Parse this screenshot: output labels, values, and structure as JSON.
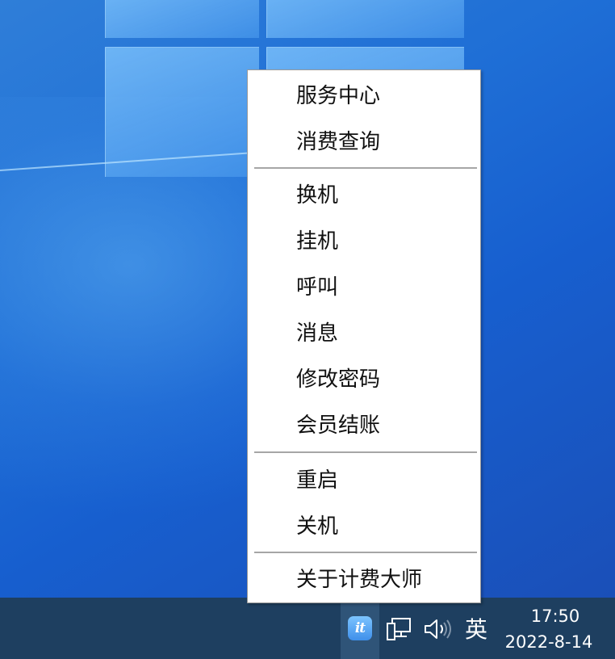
{
  "context_menu": {
    "groups": [
      {
        "items": [
          "服务中心",
          "消费查询"
        ]
      },
      {
        "items": [
          "换机",
          "挂机",
          "呼叫",
          "消息",
          "修改密码",
          "会员结账"
        ]
      },
      {
        "items": [
          "重启",
          "关机"
        ]
      },
      {
        "items": [
          "关于计费大师"
        ]
      }
    ]
  },
  "taskbar": {
    "tray": {
      "app_icon": "billing-app-icon",
      "app_icon_glyph": "it",
      "network_icon": "network-icon",
      "volume_icon": "volume-icon",
      "ime_indicator": "英"
    },
    "clock": {
      "time": "17:50",
      "date": "2022-8-14"
    }
  },
  "colors": {
    "taskbar": "#1e3f60",
    "menu_background": "#ffffff",
    "menu_separator": "#a6a6a6",
    "desktop_accent": "#1f6fd6"
  }
}
